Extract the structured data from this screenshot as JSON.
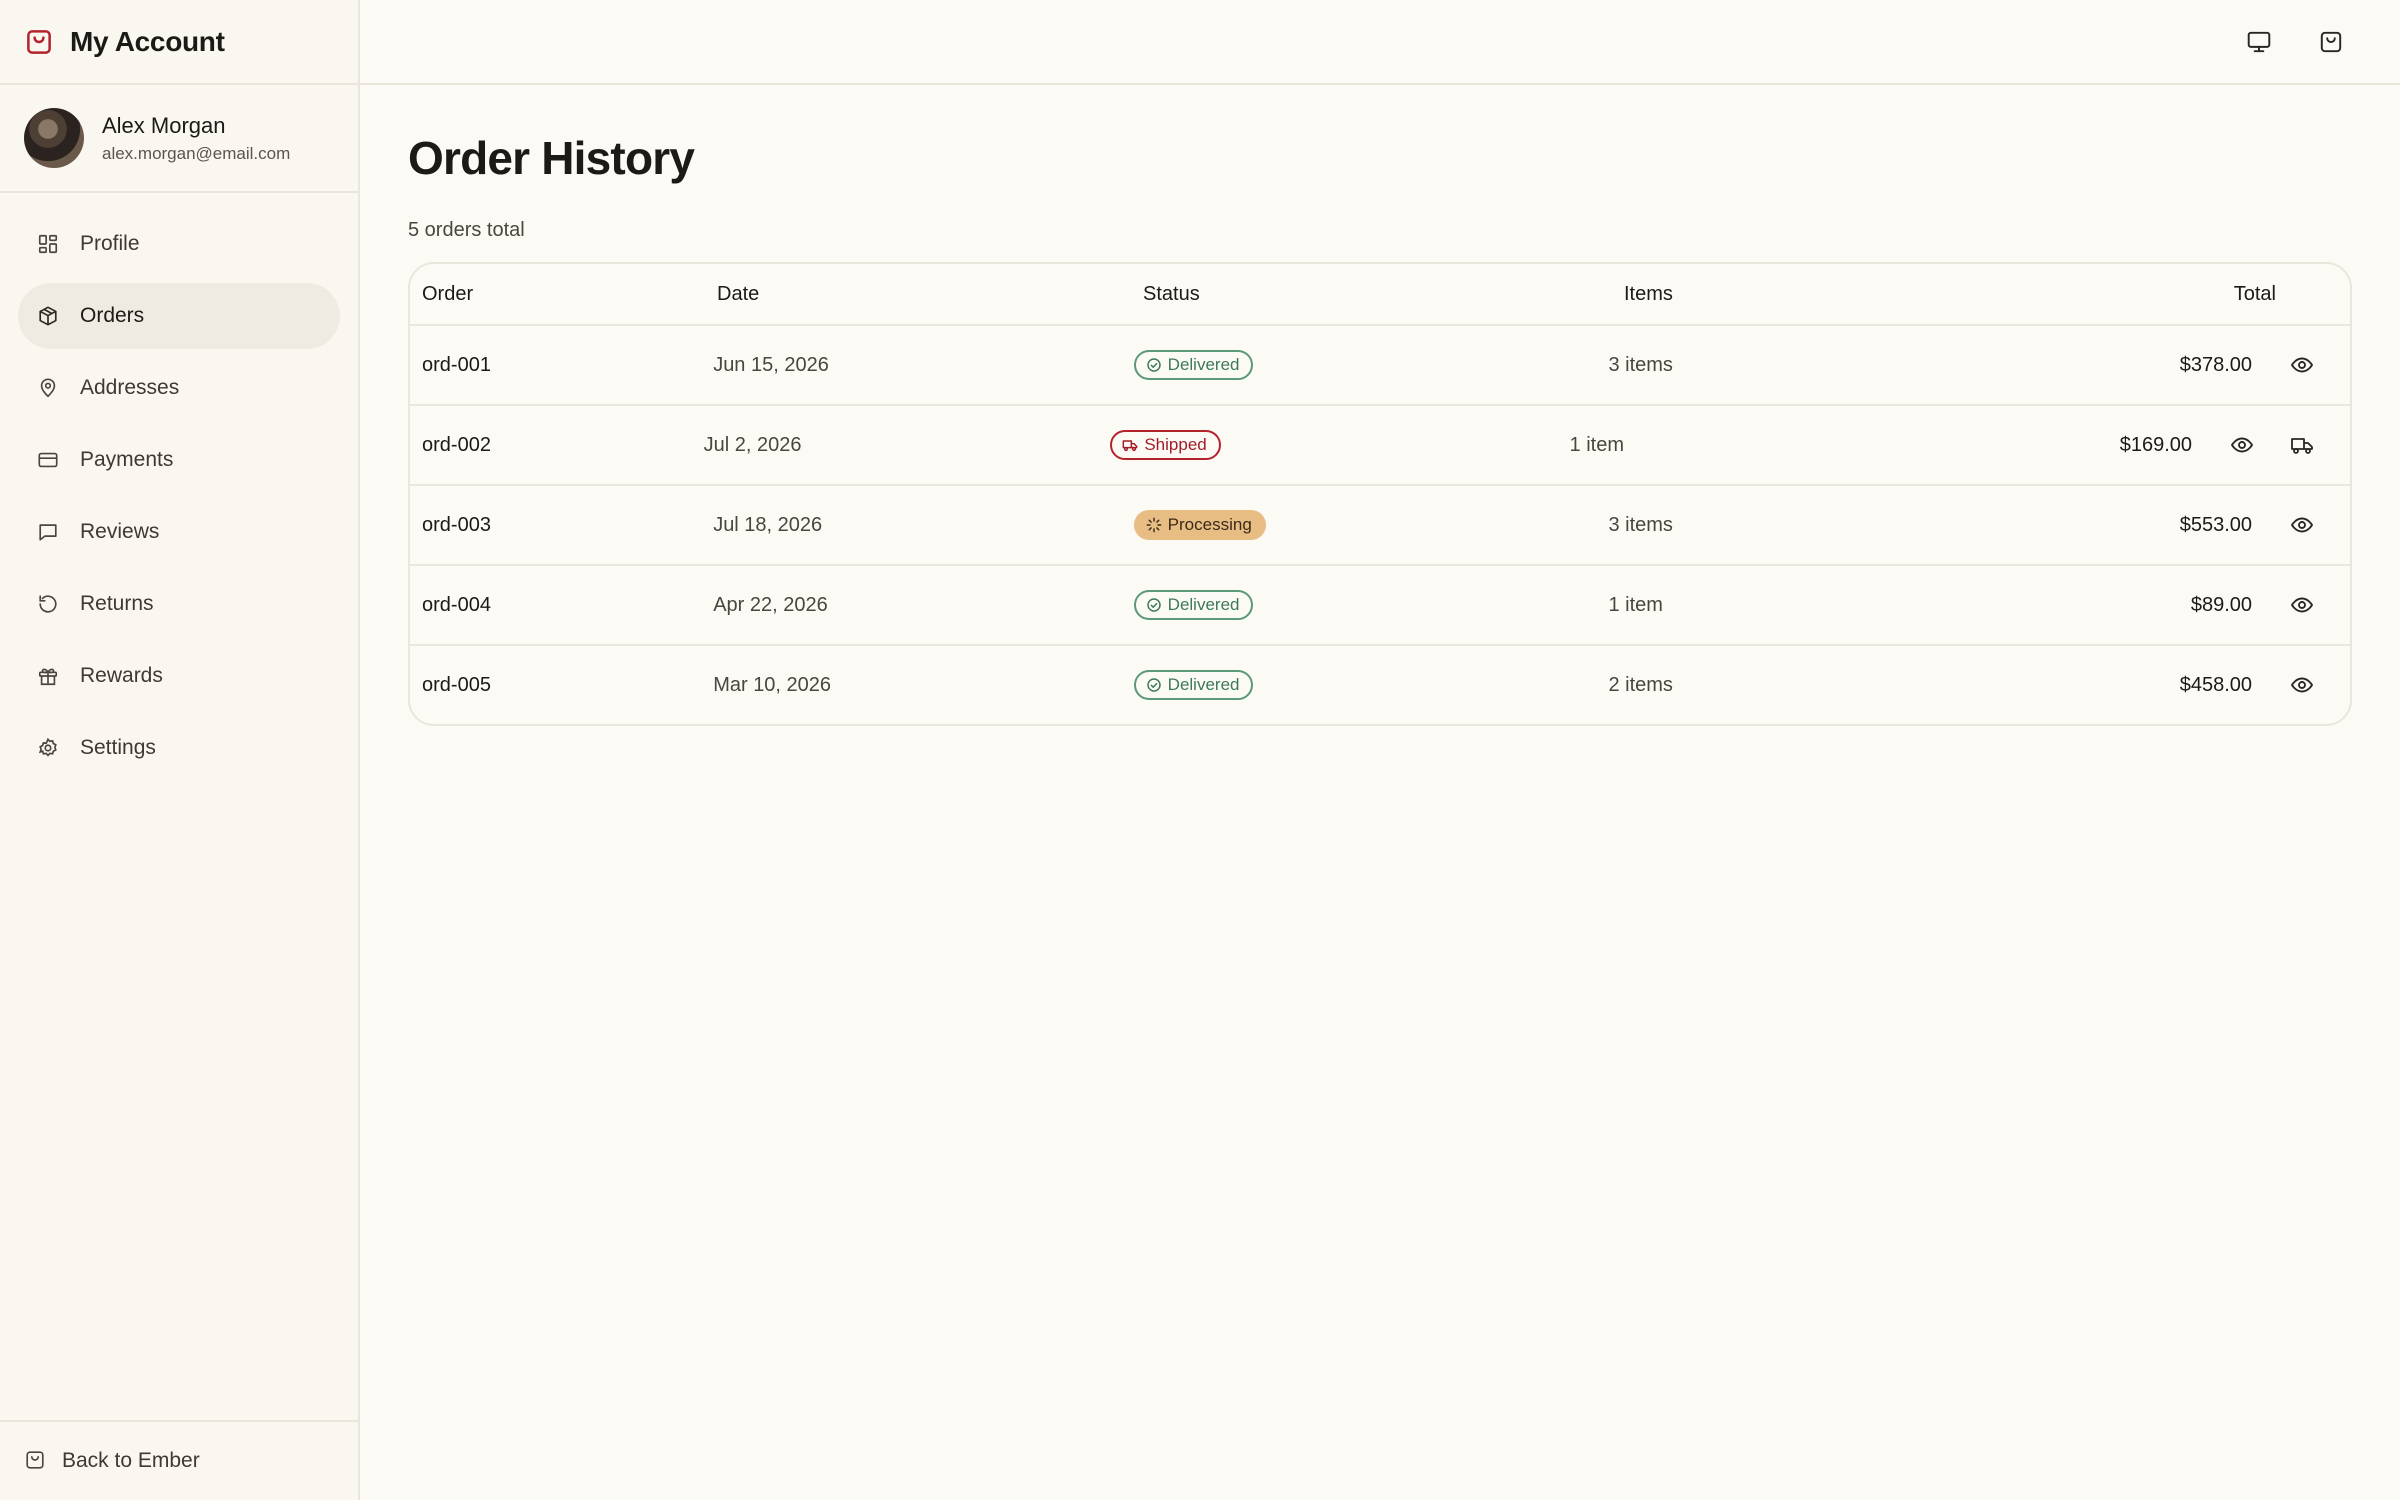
{
  "app": {
    "title": "My Account",
    "brand_color": "#b3232e"
  },
  "user": {
    "name": "Alex Morgan",
    "email": "alex.morgan@email.com"
  },
  "sidebar": {
    "items": [
      {
        "label": "Profile",
        "icon": "grid-icon",
        "active": false
      },
      {
        "label": "Orders",
        "icon": "package-icon",
        "active": true
      },
      {
        "label": "Addresses",
        "icon": "map-pin-icon",
        "active": false
      },
      {
        "label": "Payments",
        "icon": "credit-card-icon",
        "active": false
      },
      {
        "label": "Reviews",
        "icon": "message-square-icon",
        "active": false
      },
      {
        "label": "Returns",
        "icon": "rotate-ccw-icon",
        "active": false
      },
      {
        "label": "Rewards",
        "icon": "gift-icon",
        "active": false
      },
      {
        "label": "Settings",
        "icon": "gear-icon",
        "active": false
      }
    ],
    "back_label": "Back to Ember"
  },
  "main": {
    "title": "Order History",
    "subtitle": "5 orders total",
    "columns": {
      "order": "Order",
      "date": "Date",
      "status": "Status",
      "items": "Items",
      "total": "Total"
    },
    "orders": [
      {
        "id": "ord-001",
        "date": "Jun 15, 2026",
        "status": "Delivered",
        "items": "3 items",
        "total": "$378.00"
      },
      {
        "id": "ord-002",
        "date": "Jul 2, 2026",
        "status": "Shipped",
        "items": "1 item",
        "total": "$169.00"
      },
      {
        "id": "ord-003",
        "date": "Jul 18, 2026",
        "status": "Processing",
        "items": "3 items",
        "total": "$553.00"
      },
      {
        "id": "ord-004",
        "date": "Apr 22, 2026",
        "status": "Delivered",
        "items": "1 item",
        "total": "$89.00"
      },
      {
        "id": "ord-005",
        "date": "Mar 10, 2026",
        "status": "Delivered",
        "items": "2 items",
        "total": "$458.00"
      }
    ]
  },
  "colors": {
    "background": "#fcfaf5",
    "delivered": "#3d7a59",
    "shipped": "#a31d28",
    "processing": "#e8bd84"
  }
}
